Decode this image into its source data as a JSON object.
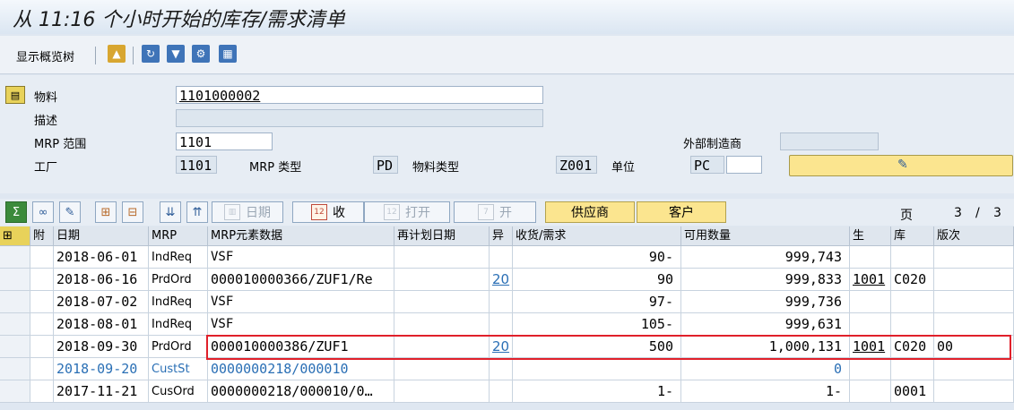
{
  "window": {
    "title": "从 11:16 个小时开始的库存/需求清单"
  },
  "toolbar": {
    "overview_tree_label": "显示概览树"
  },
  "header": {
    "material_label": "物料",
    "material_value": "1101000002",
    "description_label": "描述",
    "description_value": "",
    "mrp_area_label": "MRP 范围",
    "mrp_area_value": "1101",
    "external_mfr_label": "外部制造商",
    "external_mfr_value": "",
    "plant_label": "工厂",
    "plant_value": "1101",
    "mrp_type_label": "MRP 类型",
    "mrp_type_value": "PD",
    "material_type_label": "物料类型",
    "material_type_value": "Z001",
    "unit_label": "单位",
    "unit_value": "PC"
  },
  "grid_toolbar": {
    "date_label": "日期",
    "receive_label": "收",
    "open_label": "打开",
    "open2_label": "开",
    "vendor_label": "供应商",
    "customer_label": "客户",
    "page_label": "页",
    "page_current": "3",
    "page_sep": "/",
    "page_total": "3"
  },
  "table": {
    "columns": {
      "attach": "附",
      "date": "日期",
      "mrp": "MRP",
      "element": "MRP元素数据",
      "reschedule": "再计划日期",
      "exception": "异",
      "receipt": "收货/需求",
      "available": "可用数量",
      "prod": "生",
      "stor": "库",
      "version": "版次"
    },
    "rows": [
      {
        "date": "2018-06-01",
        "mrp": "IndReq",
        "element": "VSF",
        "reschedule": "",
        "exception": "",
        "receipt": "90-",
        "available": "999,743",
        "prod": "",
        "stor": "",
        "version": ""
      },
      {
        "date": "2018-06-16",
        "mrp": "PrdOrd",
        "element": "000010000366/ZUF1/Re",
        "reschedule": "",
        "exception": "20",
        "receipt": "90",
        "available": "999,833",
        "prod": "1001",
        "stor": "C020",
        "version": ""
      },
      {
        "date": "2018-07-02",
        "mrp": "IndReq",
        "element": "VSF",
        "reschedule": "",
        "exception": "",
        "receipt": "97-",
        "available": "999,736",
        "prod": "",
        "stor": "",
        "version": ""
      },
      {
        "date": "2018-08-01",
        "mrp": "IndReq",
        "element": "VSF",
        "reschedule": "",
        "exception": "",
        "receipt": "105-",
        "available": "999,631",
        "prod": "",
        "stor": "",
        "version": ""
      },
      {
        "date": "2018-09-30",
        "mrp": "PrdOrd",
        "element": "000010000386/ZUF1",
        "reschedule": "",
        "exception": "20",
        "receipt": "500",
        "available": "1,000,131",
        "prod": "1001",
        "stor": "C020",
        "version": "00"
      },
      {
        "date": "2018-09-20",
        "mrp": "CustSt",
        "element": "0000000218/000010",
        "reschedule": "",
        "exception": "",
        "receipt": "",
        "available": "0",
        "prod": "",
        "stor": "",
        "version": ""
      },
      {
        "date": "2017-11-21",
        "mrp": "CusOrd",
        "element": "0000000218/000010/0…",
        "reschedule": "",
        "exception": "",
        "receipt": "1-",
        "available": "1-",
        "prod": "",
        "stor": "0001",
        "version": ""
      }
    ]
  }
}
